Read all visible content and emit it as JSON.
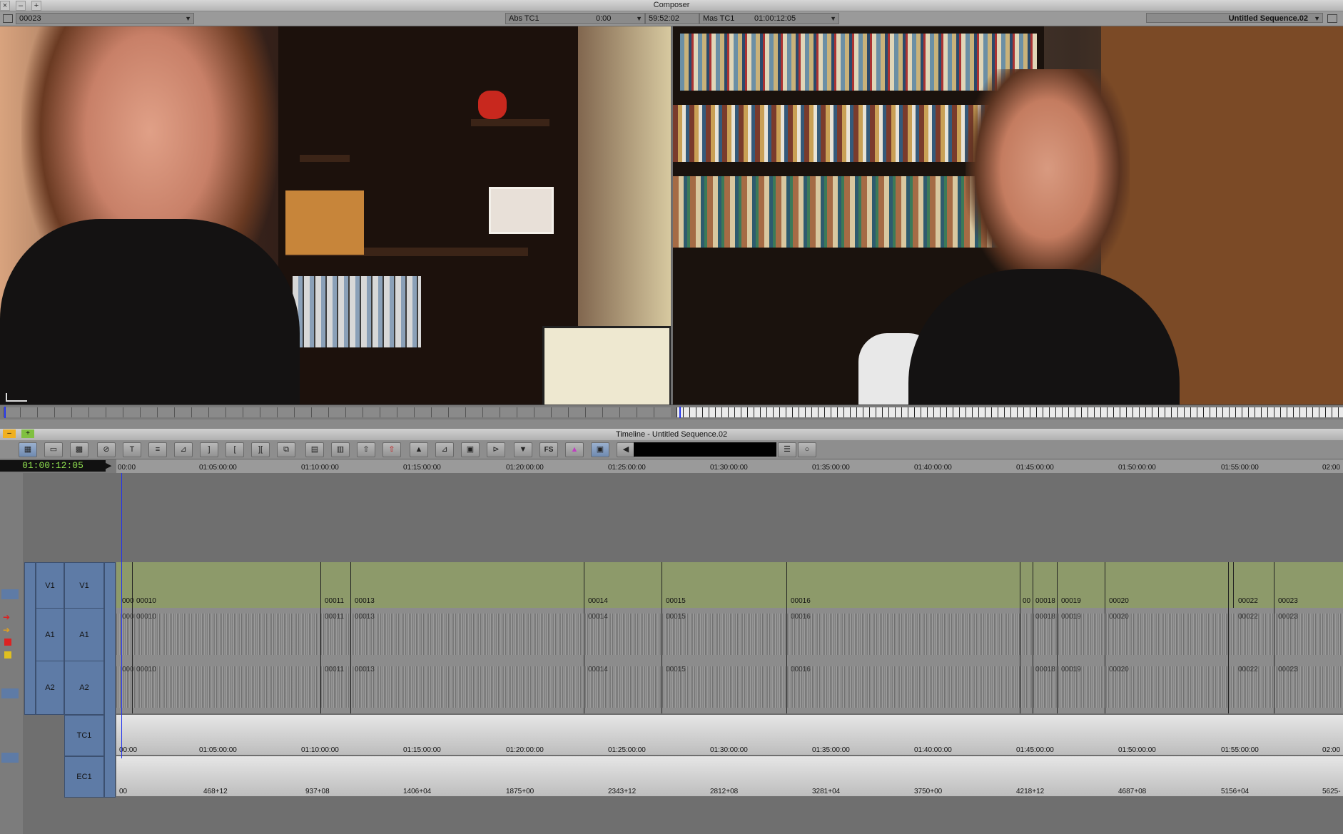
{
  "composer": {
    "title": "Composer",
    "clip_name": "00023",
    "abs_tc_label": "Abs TC1",
    "abs_tc_value": "0:00",
    "duration": "59:52:02",
    "mas_tc_label": "Mas TC1",
    "mas_tc_value": "01:00:12:05",
    "sequence_name": "Untitled Sequence.02"
  },
  "timeline": {
    "title": "Timeline - Untitled Sequence.02",
    "timecode": "01:00:12:05",
    "ruler_labels": [
      "00:00",
      "01:05:00:00",
      "01:10:00:00",
      "01:15:00:00",
      "01:20:00:00",
      "01:25:00:00",
      "01:30:00:00",
      "01:35:00:00",
      "01:40:00:00",
      "01:45:00:00",
      "01:50:00:00",
      "01:55:00:00",
      "02:00"
    ],
    "ec_labels": [
      "00",
      "468+12",
      "937+08",
      "1406+04",
      "1875+00",
      "2343+12",
      "2812+08",
      "3281+04",
      "3750+00",
      "4218+12",
      "4687+08",
      "5156+04",
      "5625-"
    ],
    "toolbar_fs": "FS",
    "tracks": {
      "v1_source": "V1",
      "v1": "V1",
      "a1_source": "A1",
      "a1": "A1",
      "a2_source": "A2",
      "a2": "A2",
      "tc1": "TC1",
      "ec1": "EC1"
    },
    "clips": [
      "000",
      "00010",
      "00011",
      "00013",
      "00014",
      "00015",
      "00016",
      "00",
      "00018",
      "00019",
      "00020",
      "00022",
      "00023"
    ]
  },
  "colors": {
    "video_track": "#8d9a6a",
    "track_header": "#5e7ba6",
    "playhead": "#2233ee",
    "timecode_text": "#8fe04f"
  }
}
